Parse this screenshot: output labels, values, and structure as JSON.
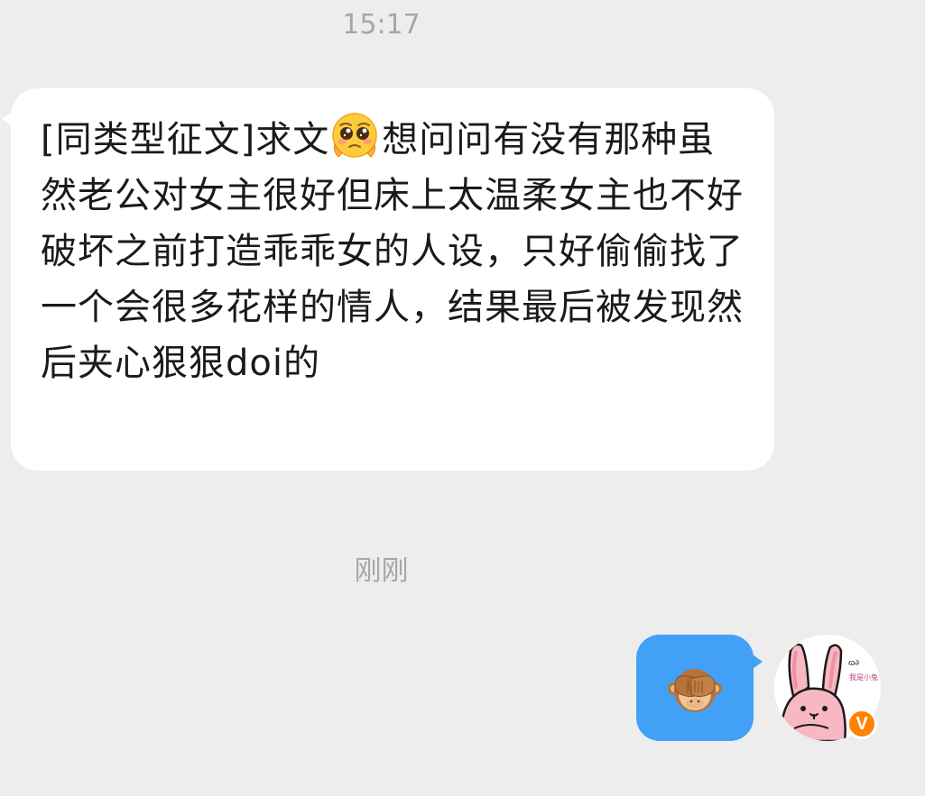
{
  "chat": {
    "timestamps": {
      "first": "15:17",
      "second": "刚刚"
    },
    "incoming_message": {
      "prefix": "[同类型征文]求文",
      "emoji": "pleading-face",
      "body": "想问问有没有那种虽然老公对女主很好但床上太温柔女主也不好破坏之前打造乖乖女的人设，只好偷偷找了一个会很多花样的情人，结果最后被发现然后夹心狠狠doi的"
    },
    "outgoing_message": {
      "emoji": "see-no-evil-monkey"
    },
    "avatar": {
      "verified_badge": "V",
      "caption": "我是小兔"
    }
  },
  "colors": {
    "background": "#ededed",
    "incoming_bubble": "#ffffff",
    "outgoing_bubble": "#42a1f6",
    "timestamp_text": "#a6a6a6",
    "verified_badge": "#ff8200"
  }
}
